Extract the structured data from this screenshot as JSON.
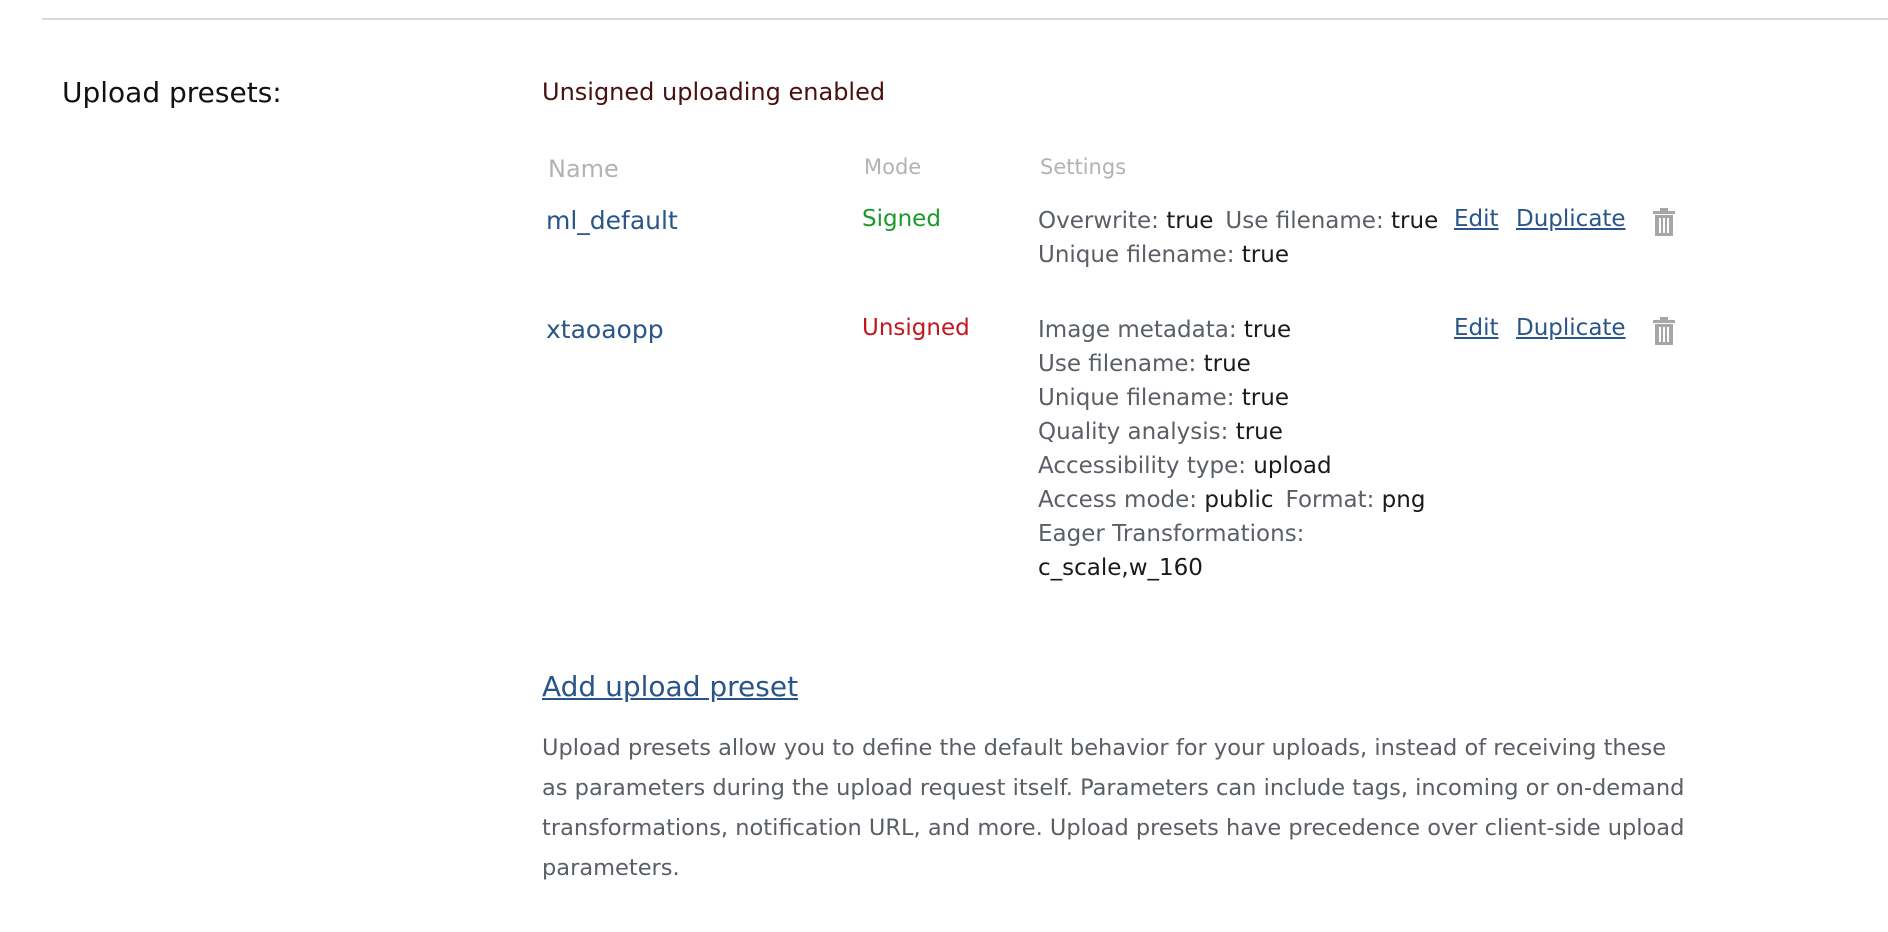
{
  "section": {
    "label": "Upload presets:",
    "status": "Unsigned uploading enabled"
  },
  "table": {
    "headers": {
      "name": "Name",
      "mode": "Mode",
      "settings": "Settings"
    },
    "rows": [
      {
        "name": "ml_default",
        "mode": "Signed",
        "mode_color": "#1a9a2a",
        "settings": [
          [
            {
              "key": "Overwrite:",
              "value": "true"
            },
            {
              "key": "Use filename:",
              "value": "true"
            }
          ],
          [
            {
              "key": "Unique filename:",
              "value": "true"
            }
          ]
        ],
        "edit_label": "Edit",
        "duplicate_label": "Duplicate"
      },
      {
        "name": "xtaoaopp",
        "mode": "Unsigned",
        "mode_color": "#c4161c",
        "settings": [
          [
            {
              "key": "Image metadata:",
              "value": "true"
            }
          ],
          [
            {
              "key": "Use filename:",
              "value": "true"
            }
          ],
          [
            {
              "key": "Unique filename:",
              "value": "true"
            }
          ],
          [
            {
              "key": "Quality analysis:",
              "value": "true"
            }
          ],
          [
            {
              "key": "Accessibility type:",
              "value": "upload"
            }
          ],
          [
            {
              "key": "Access mode:",
              "value": "public"
            },
            {
              "key": "Format:",
              "value": "png"
            }
          ],
          [
            {
              "key": "Eager Transformations:",
              "value": ""
            }
          ],
          [
            {
              "key": "",
              "value": "c_scale,w_160"
            }
          ]
        ],
        "edit_label": "Edit",
        "duplicate_label": "Duplicate"
      }
    ]
  },
  "add_preset_label": "Add upload preset",
  "help_text": "Upload presets allow you to define the default behavior for your uploads, instead of receiving these as parameters during the upload request itself. Parameters can include tags, incoming or on-demand transformations, notification URL, and more. Upload presets have precedence over client-side upload parameters.",
  "icons": {
    "delete": "trash-icon"
  },
  "colors": {
    "link": "#2a5588",
    "status": "#4a0f0f",
    "signed": "#1a9a2a",
    "unsigned": "#c4161c",
    "header": "#b3b3b3",
    "trash": "#a6a6a6"
  }
}
